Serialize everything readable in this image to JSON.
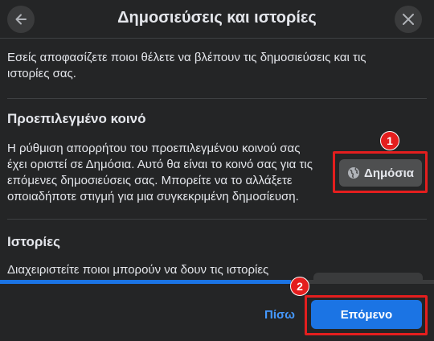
{
  "header": {
    "title": "Δημοσιεύσεις και ιστορίες",
    "back_icon": "arrow-left-icon",
    "close_icon": "close-icon"
  },
  "intro": "Εσείς αποφασίζετε ποιοι θέλετε να βλέπουν τις δημοσιεύσεις και τις ιστορίες σας.",
  "default_audience": {
    "heading": "Προεπιλεγμένο κοινό",
    "description": "Η ρύθμιση απορρήτου του προεπιλεγμένου κοινού σας έχει οριστεί σε Δημόσια. Αυτό θα είναι το κοινό σας για τις επόμενες δημοσιεύσεις σας. Μπορείτε να το αλλάξετε οποιαδήποτε στιγμή για μια συγκεκριμένη δημοσίευση.",
    "button_label": "Δημόσια",
    "button_icon": "globe-icon"
  },
  "stories": {
    "heading": "Ιστορίες",
    "description": "Διαχειριστείτε ποιοι μπορούν να δουν τις ιστορίες"
  },
  "progress": {
    "fraction": 0.67
  },
  "footer": {
    "back_label": "Πίσω",
    "next_label": "Επόμενο"
  },
  "annotations": {
    "badge_1": "1",
    "badge_2": "2",
    "color": "#e41e1e"
  },
  "colors": {
    "background": "#242526",
    "accent": "#1b74e4",
    "link": "#4599ff"
  }
}
